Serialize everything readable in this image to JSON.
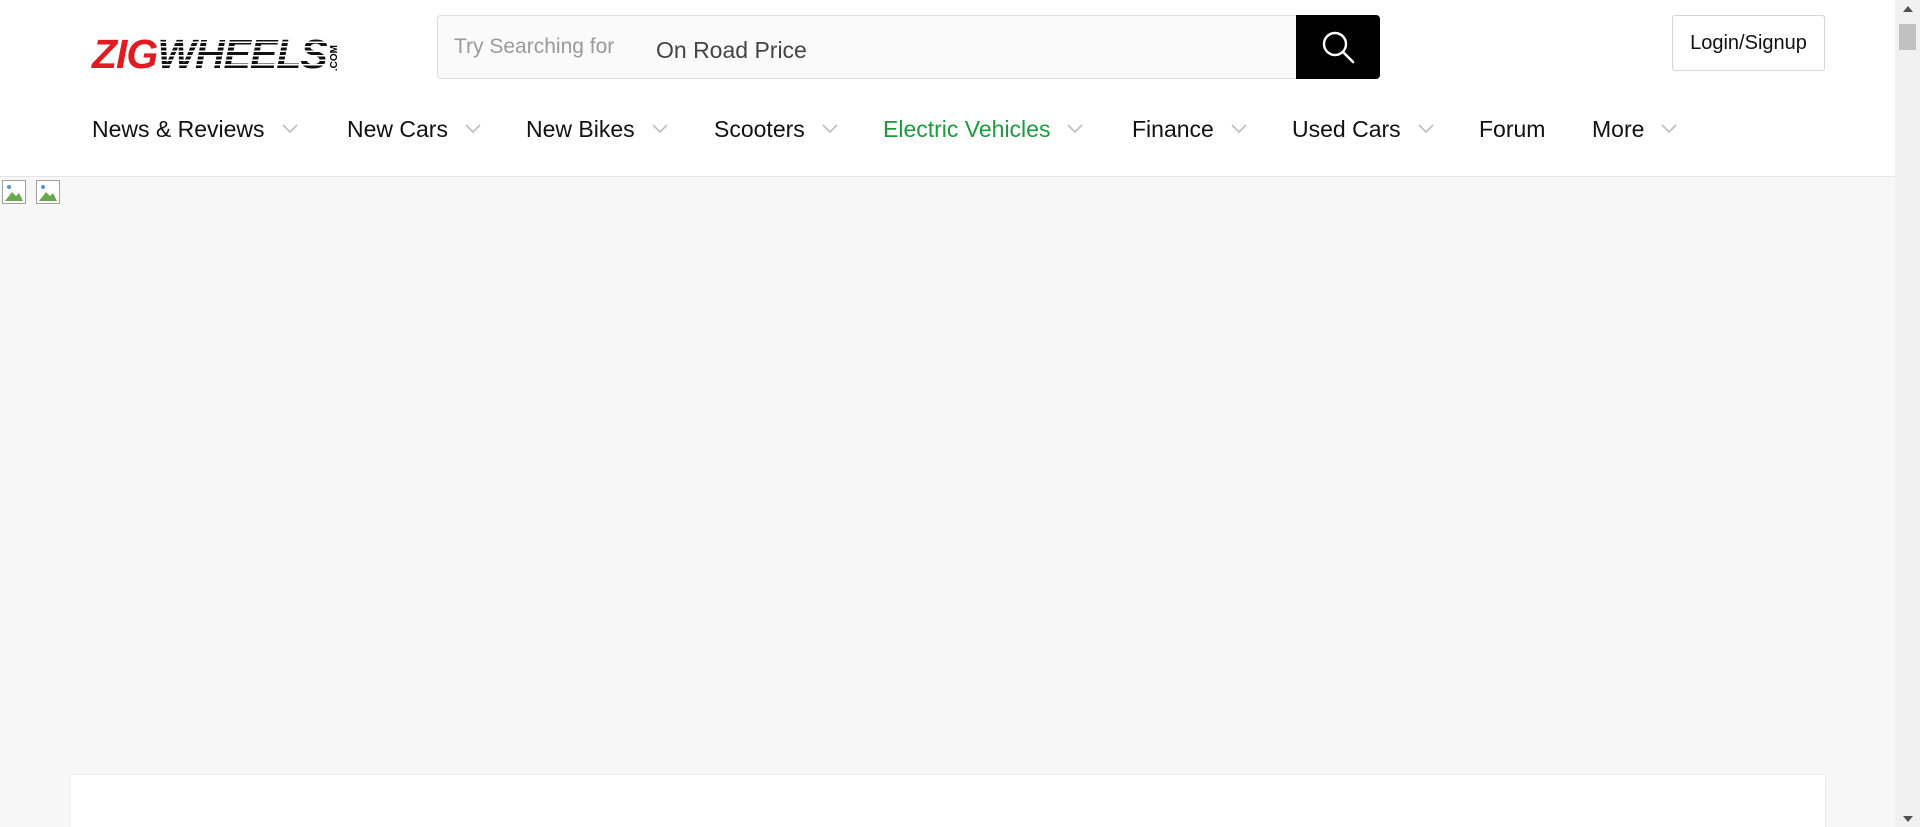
{
  "logo": {
    "part1": "ZIG",
    "part2": "WHEELS",
    "suffix": ".COM",
    "brand_red": "#e01b22"
  },
  "search": {
    "hint": "Try Searching for",
    "term": "On Road Price",
    "icon": "search-icon"
  },
  "login_label": "Login/Signup",
  "nav": {
    "items": [
      {
        "label": "News & Reviews",
        "has_dropdown": true
      },
      {
        "label": "New Cars",
        "has_dropdown": true
      },
      {
        "label": "New Bikes",
        "has_dropdown": true
      },
      {
        "label": "Scooters",
        "has_dropdown": true
      },
      {
        "label": "Electric Vehicles",
        "has_dropdown": true,
        "color": "#1a9c3e"
      },
      {
        "label": "Finance",
        "has_dropdown": true
      },
      {
        "label": "Used Cars",
        "has_dropdown": true
      },
      {
        "label": "Forum",
        "has_dropdown": false
      },
      {
        "label": "More",
        "has_dropdown": true
      }
    ]
  },
  "colors": {
    "ev_green": "#1a9c3e",
    "search_button": "#000000"
  }
}
